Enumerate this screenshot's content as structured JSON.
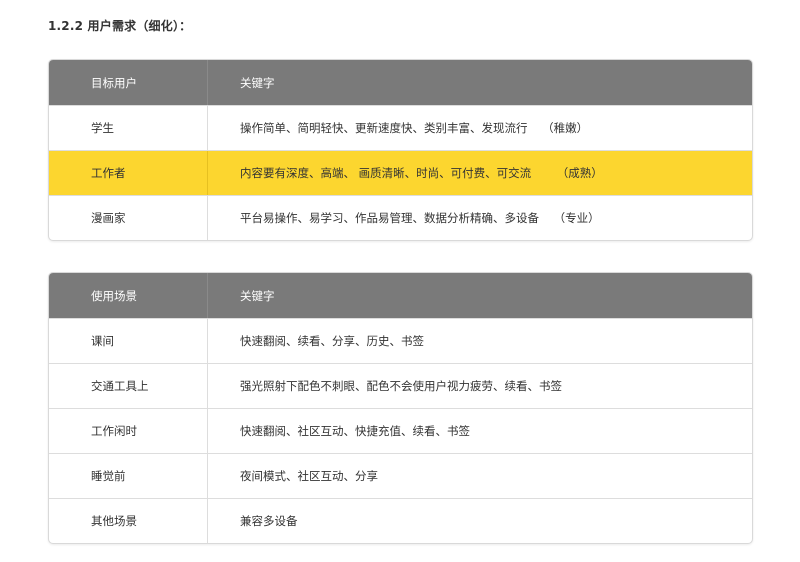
{
  "heading": "1.2.2 用户需求（细化）：",
  "table1": {
    "header": [
      "目标用户",
      "关键字"
    ],
    "rows": [
      {
        "user": "学生",
        "keywords": "操作简单、简明轻快、更新速度快、类别丰富、发现流行    （稚嫩）"
      },
      {
        "user": "工作者",
        "keywords": "内容要有深度、高端、 画质清晰、时尚、可付费、可交流       （成熟）"
      },
      {
        "user": "漫画家",
        "keywords": "平台易操作、易学习、作品易管理、数据分析精确、多设备    （专业）"
      }
    ],
    "highlight_color": "#fcd62f",
    "header_color": "#7a7a7a"
  },
  "table2": {
    "header": [
      "使用场景",
      "关键字"
    ],
    "rows": [
      {
        "scene": "课间",
        "keywords": "快速翻阅、续看、分享、历史、书签"
      },
      {
        "scene": "交通工具上",
        "keywords": "强光照射下配色不刺眼、配色不会使用户视力疲劳、续看、书签"
      },
      {
        "scene": "工作闲时",
        "keywords": "快速翻阅、社区互动、快捷充值、续看、书签"
      },
      {
        "scene": "睡觉前",
        "keywords": "夜间模式、社区互动、分享"
      },
      {
        "scene": "其他场景",
        "keywords": "兼容多设备"
      }
    ]
  }
}
